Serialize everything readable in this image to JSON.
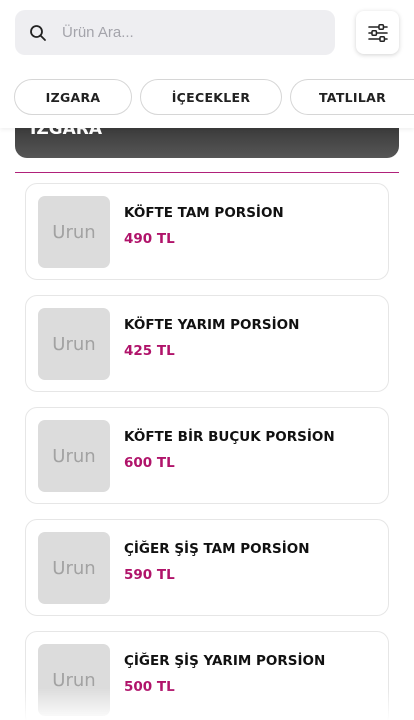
{
  "search": {
    "placeholder": "Ürün Ara..."
  },
  "categories": [
    {
      "label": "IZGARA"
    },
    {
      "label": "İÇECEKLER"
    },
    {
      "label": "TATLILAR"
    }
  ],
  "section": {
    "title": "IZGARA"
  },
  "products": [
    {
      "thumb_label": "Urun",
      "name": "KÖFTE TAM PORSİON",
      "price": "490 TL"
    },
    {
      "thumb_label": "Urun",
      "name": "KÖFTE YARIM PORSİON",
      "price": "425 TL"
    },
    {
      "thumb_label": "Urun",
      "name": "KÖFTE BİR BUÇUK PORSİON",
      "price": "600 TL"
    },
    {
      "thumb_label": "Urun",
      "name": "ÇİĞER ŞİŞ TAM PORSİON",
      "price": "590 TL"
    },
    {
      "thumb_label": "Urun",
      "name": "ÇİĞER ŞİŞ YARIM PORSİON",
      "price": "500 TL"
    }
  ],
  "colors": {
    "accent_price": "#b0136a",
    "divider": "#b0217a",
    "section_header": "#3a3a3a",
    "search_bg": "#eeeef1"
  },
  "icons": {
    "search": "search-icon",
    "filter": "sliders-icon"
  }
}
